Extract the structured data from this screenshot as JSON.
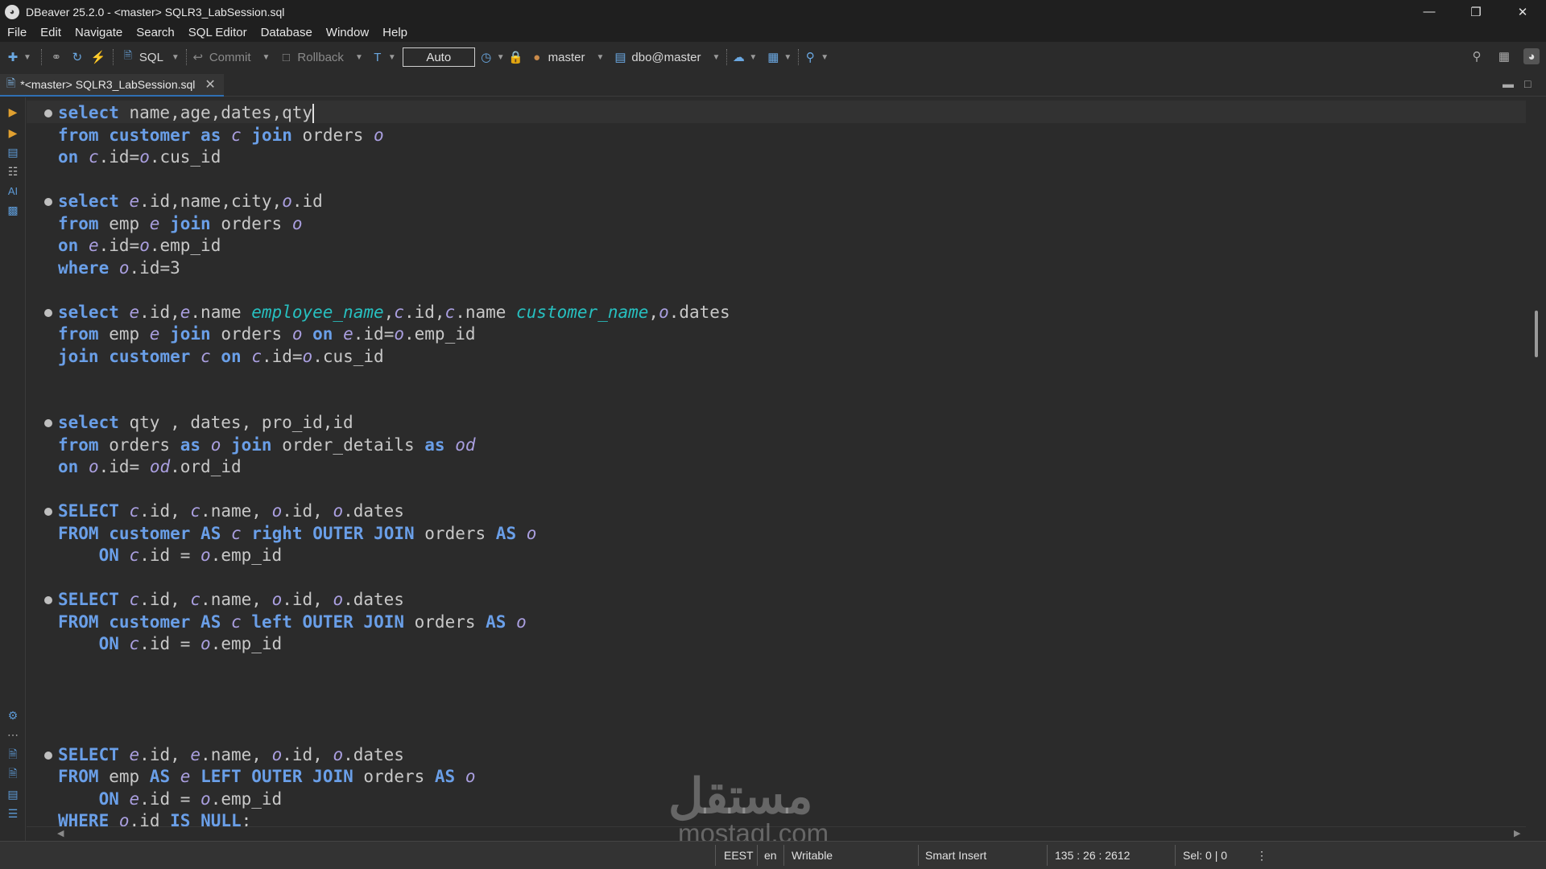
{
  "window": {
    "title": "DBeaver 25.2.0 - <master> SQLR3_LabSession.sql"
  },
  "menu": [
    "File",
    "Edit",
    "Navigate",
    "Search",
    "SQL Editor",
    "Database",
    "Window",
    "Help"
  ],
  "toolbar": {
    "sql_label": "SQL",
    "commit_label": "Commit",
    "rollback_label": "Rollback",
    "mode_value": "Auto",
    "datasource": "master",
    "schema": "dbo@master"
  },
  "tab": {
    "title": "*<master> SQLR3_LabSession.sql"
  },
  "watermark": {
    "logo": "مستقل",
    "text": "mostaql.com"
  },
  "status": {
    "timezone": "EEST",
    "locale": "en",
    "access": "Writable",
    "insert_mode": "Smart Insert",
    "cursor": "135 : 26 : 2612",
    "selection": "Sel: 0 | 0"
  },
  "code": [
    {
      "marker": true,
      "tokens": [
        [
          "kw",
          "select"
        ],
        [
          "id",
          " name,age,dates,qty"
        ]
      ],
      "caret": true
    },
    {
      "tokens": [
        [
          "kw",
          "from"
        ],
        [
          "id",
          " "
        ],
        [
          "kw",
          "customer"
        ],
        [
          "id",
          " "
        ],
        [
          "kw",
          "as"
        ],
        [
          "id",
          " "
        ],
        [
          "al",
          "c"
        ],
        [
          "id",
          " "
        ],
        [
          "kw",
          "join"
        ],
        [
          "id",
          " orders "
        ],
        [
          "al",
          "o"
        ]
      ]
    },
    {
      "tokens": [
        [
          "kw",
          "on"
        ],
        [
          "id",
          " "
        ],
        [
          "al",
          "c"
        ],
        [
          "id",
          ".id="
        ],
        [
          "al",
          "o"
        ],
        [
          "id",
          ".cus_id"
        ]
      ]
    },
    {
      "tokens": []
    },
    {
      "marker": true,
      "tokens": [
        [
          "kw",
          "select"
        ],
        [
          "id",
          " "
        ],
        [
          "al",
          "e"
        ],
        [
          "id",
          ".id,name,city,"
        ],
        [
          "al",
          "o"
        ],
        [
          "id",
          ".id"
        ]
      ]
    },
    {
      "tokens": [
        [
          "kw",
          "from"
        ],
        [
          "id",
          " emp "
        ],
        [
          "al",
          "e"
        ],
        [
          "id",
          " "
        ],
        [
          "kw",
          "join"
        ],
        [
          "id",
          " orders "
        ],
        [
          "al",
          "o"
        ]
      ]
    },
    {
      "tokens": [
        [
          "kw",
          "on"
        ],
        [
          "id",
          " "
        ],
        [
          "al",
          "e"
        ],
        [
          "id",
          ".id="
        ],
        [
          "al",
          "o"
        ],
        [
          "id",
          ".emp_id"
        ]
      ]
    },
    {
      "tokens": [
        [
          "kw",
          "where"
        ],
        [
          "id",
          " "
        ],
        [
          "al",
          "o"
        ],
        [
          "id",
          ".id=3"
        ]
      ]
    },
    {
      "tokens": []
    },
    {
      "marker": true,
      "tokens": [
        [
          "kw",
          "select"
        ],
        [
          "id",
          " "
        ],
        [
          "al",
          "e"
        ],
        [
          "id",
          ".id,"
        ],
        [
          "al",
          "e"
        ],
        [
          "id",
          ".name "
        ],
        [
          "cal",
          "employee_name"
        ],
        [
          "id",
          ","
        ],
        [
          "al",
          "c"
        ],
        [
          "id",
          ".id,"
        ],
        [
          "al",
          "c"
        ],
        [
          "id",
          ".name "
        ],
        [
          "cal",
          "customer_name"
        ],
        [
          "id",
          ","
        ],
        [
          "al",
          "o"
        ],
        [
          "id",
          ".dates"
        ]
      ]
    },
    {
      "tokens": [
        [
          "kw",
          "from"
        ],
        [
          "id",
          " emp "
        ],
        [
          "al",
          "e"
        ],
        [
          "id",
          " "
        ],
        [
          "kw",
          "join"
        ],
        [
          "id",
          " orders "
        ],
        [
          "al",
          "o"
        ],
        [
          "id",
          " "
        ],
        [
          "kw",
          "on"
        ],
        [
          "id",
          " "
        ],
        [
          "al",
          "e"
        ],
        [
          "id",
          ".id="
        ],
        [
          "al",
          "o"
        ],
        [
          "id",
          ".emp_id"
        ]
      ]
    },
    {
      "tokens": [
        [
          "kw",
          "join"
        ],
        [
          "id",
          " "
        ],
        [
          "kw",
          "customer"
        ],
        [
          "id",
          " "
        ],
        [
          "al",
          "c"
        ],
        [
          "id",
          " "
        ],
        [
          "kw",
          "on"
        ],
        [
          "id",
          " "
        ],
        [
          "al",
          "c"
        ],
        [
          "id",
          ".id="
        ],
        [
          "al",
          "o"
        ],
        [
          "id",
          ".cus_id"
        ]
      ]
    },
    {
      "tokens": []
    },
    {
      "tokens": []
    },
    {
      "marker": true,
      "tokens": [
        [
          "kw",
          "select"
        ],
        [
          "id",
          " qty , dates, pro_id,id"
        ]
      ]
    },
    {
      "tokens": [
        [
          "kw",
          "from"
        ],
        [
          "id",
          " orders "
        ],
        [
          "kw",
          "as"
        ],
        [
          "id",
          " "
        ],
        [
          "al",
          "o"
        ],
        [
          "id",
          " "
        ],
        [
          "kw",
          "join"
        ],
        [
          "id",
          " order_details "
        ],
        [
          "kw",
          "as"
        ],
        [
          "id",
          " "
        ],
        [
          "al",
          "od"
        ]
      ]
    },
    {
      "tokens": [
        [
          "kw",
          "on"
        ],
        [
          "id",
          " "
        ],
        [
          "al",
          "o"
        ],
        [
          "id",
          ".id= "
        ],
        [
          "al",
          "od"
        ],
        [
          "id",
          ".ord_id"
        ]
      ]
    },
    {
      "tokens": []
    },
    {
      "marker": true,
      "tokens": [
        [
          "kw",
          "SELECT"
        ],
        [
          "id",
          " "
        ],
        [
          "al",
          "c"
        ],
        [
          "id",
          ".id, "
        ],
        [
          "al",
          "c"
        ],
        [
          "id",
          ".name, "
        ],
        [
          "al",
          "o"
        ],
        [
          "id",
          ".id, "
        ],
        [
          "al",
          "o"
        ],
        [
          "id",
          ".dates"
        ]
      ]
    },
    {
      "tokens": [
        [
          "kw",
          "FROM"
        ],
        [
          "id",
          " "
        ],
        [
          "kw",
          "customer"
        ],
        [
          "id",
          " "
        ],
        [
          "kw",
          "AS"
        ],
        [
          "id",
          " "
        ],
        [
          "al",
          "c"
        ],
        [
          "id",
          " "
        ],
        [
          "kw",
          "right"
        ],
        [
          "id",
          " "
        ],
        [
          "kw",
          "OUTER"
        ],
        [
          "id",
          " "
        ],
        [
          "kw",
          "JOIN"
        ],
        [
          "id",
          " orders "
        ],
        [
          "kw",
          "AS"
        ],
        [
          "id",
          " "
        ],
        [
          "al",
          "o"
        ]
      ]
    },
    {
      "tokens": [
        [
          "id",
          "    "
        ],
        [
          "kw",
          "ON"
        ],
        [
          "id",
          " "
        ],
        [
          "al",
          "c"
        ],
        [
          "id",
          ".id = "
        ],
        [
          "al",
          "o"
        ],
        [
          "id",
          ".emp_id"
        ]
      ]
    },
    {
      "tokens": []
    },
    {
      "marker": true,
      "tokens": [
        [
          "kw",
          "SELECT"
        ],
        [
          "id",
          " "
        ],
        [
          "al",
          "c"
        ],
        [
          "id",
          ".id, "
        ],
        [
          "al",
          "c"
        ],
        [
          "id",
          ".name, "
        ],
        [
          "al",
          "o"
        ],
        [
          "id",
          ".id, "
        ],
        [
          "al",
          "o"
        ],
        [
          "id",
          ".dates"
        ]
      ]
    },
    {
      "tokens": [
        [
          "kw",
          "FROM"
        ],
        [
          "id",
          " "
        ],
        [
          "kw",
          "customer"
        ],
        [
          "id",
          " "
        ],
        [
          "kw",
          "AS"
        ],
        [
          "id",
          " "
        ],
        [
          "al",
          "c"
        ],
        [
          "id",
          " "
        ],
        [
          "kw",
          "left"
        ],
        [
          "id",
          " "
        ],
        [
          "kw",
          "OUTER"
        ],
        [
          "id",
          " "
        ],
        [
          "kw",
          "JOIN"
        ],
        [
          "id",
          " orders "
        ],
        [
          "kw",
          "AS"
        ],
        [
          "id",
          " "
        ],
        [
          "al",
          "o"
        ]
      ]
    },
    {
      "tokens": [
        [
          "id",
          "    "
        ],
        [
          "kw",
          "ON"
        ],
        [
          "id",
          " "
        ],
        [
          "al",
          "c"
        ],
        [
          "id",
          ".id = "
        ],
        [
          "al",
          "o"
        ],
        [
          "id",
          ".emp_id"
        ]
      ]
    },
    {
      "tokens": []
    },
    {
      "tokens": []
    },
    {
      "tokens": []
    },
    {
      "tokens": []
    },
    {
      "marker": true,
      "tokens": [
        [
          "kw",
          "SELECT"
        ],
        [
          "id",
          " "
        ],
        [
          "al",
          "e"
        ],
        [
          "id",
          ".id, "
        ],
        [
          "al",
          "e"
        ],
        [
          "id",
          ".name, "
        ],
        [
          "al",
          "o"
        ],
        [
          "id",
          ".id, "
        ],
        [
          "al",
          "o"
        ],
        [
          "id",
          ".dates"
        ]
      ]
    },
    {
      "tokens": [
        [
          "kw",
          "FROM"
        ],
        [
          "id",
          " emp "
        ],
        [
          "kw",
          "AS"
        ],
        [
          "id",
          " "
        ],
        [
          "al",
          "e"
        ],
        [
          "id",
          " "
        ],
        [
          "kw",
          "LEFT"
        ],
        [
          "id",
          " "
        ],
        [
          "kw",
          "OUTER"
        ],
        [
          "id",
          " "
        ],
        [
          "kw",
          "JOIN"
        ],
        [
          "id",
          " orders "
        ],
        [
          "kw",
          "AS"
        ],
        [
          "id",
          " "
        ],
        [
          "al",
          "o"
        ]
      ]
    },
    {
      "tokens": [
        [
          "id",
          "    "
        ],
        [
          "kw",
          "ON"
        ],
        [
          "id",
          " "
        ],
        [
          "al",
          "e"
        ],
        [
          "id",
          ".id = "
        ],
        [
          "al",
          "o"
        ],
        [
          "id",
          ".emp_id"
        ]
      ]
    },
    {
      "tokens": [
        [
          "kw",
          "WHERE"
        ],
        [
          "id",
          " "
        ],
        [
          "al",
          "o"
        ],
        [
          "id",
          ".id "
        ],
        [
          "kw",
          "IS"
        ],
        [
          "id",
          " "
        ],
        [
          "kw",
          "NULL"
        ],
        [
          "id",
          ";"
        ]
      ]
    }
  ]
}
